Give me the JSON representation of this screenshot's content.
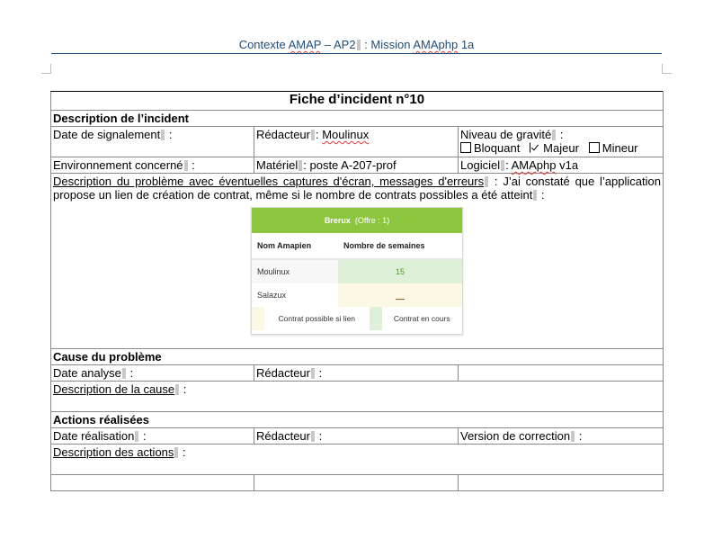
{
  "header": {
    "prefix": "Contexte ",
    "amap": "AMAP",
    "middle": " – AP2",
    "after_mark": " : Mission ",
    "amaphp": "AMAphp",
    "suffix": " 1a"
  },
  "form": {
    "title": "Fiche d’incident n°10",
    "sections": {
      "description": "Description de l’incident",
      "cause": "Cause du problème",
      "actions": "Actions réalisées"
    },
    "date_signalement": "Date de signalement",
    "redacteur_label": "Rédacteur",
    "redacteur_value": "Moulinux",
    "niveau_gravite": "Niveau de gravité",
    "gravity_options": [
      {
        "label": "Bloquant",
        "checked": false
      },
      {
        "label": "Majeur",
        "checked": true
      },
      {
        "label": "Mineur",
        "checked": false
      }
    ],
    "environnement": "Environnement concerné",
    "materiel_label": "Matériel",
    "materiel_value": "poste A-207-prof",
    "logiciel_label": "Logiciel",
    "logiciel_app": "AMAphp",
    "logiciel_version": " v1a",
    "desc_probleme_label": "Description du problème avec éventuelles captures d'écran, messages d'erreurs",
    "desc_probleme_text_1": " : J’ai constaté que l’application propose un lien de création de contrat, même si le nombre de contrats possibles a été atteint",
    "desc_probleme_text_2": " :",
    "date_analyse": "Date analyse",
    "desc_cause": "Description de la cause",
    "date_realisation": "Date réalisation",
    "version_correction": "Version de correction",
    "desc_actions": "Description des actions",
    "colon": " :"
  },
  "screenshot": {
    "title": "Brerux",
    "subtitle": "(Offre : 1)",
    "col_name": "Nom Amapien",
    "col_weeks": "Nombre de semaines",
    "rows": [
      {
        "name": "Moulinux",
        "weeks": "15"
      },
      {
        "name": "Salazux",
        "weeks": "__"
      }
    ],
    "legend_possible": "Contrat possible si lien",
    "legend_current": "Contrat en cours",
    "colors": {
      "header": "#8cc63f",
      "current": "#dff0d8",
      "possible": "#fcf8e3"
    }
  }
}
